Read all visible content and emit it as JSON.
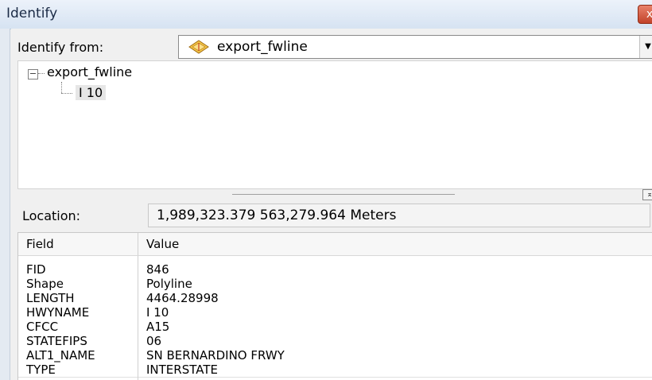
{
  "window": {
    "title": "Identify",
    "close_label": "x"
  },
  "identify_from": {
    "label": "Identify from:",
    "value": "export_fwline"
  },
  "tree": {
    "root_label": "export_fwline",
    "child_label": "I 10",
    "expander_symbol": "−"
  },
  "location": {
    "label": "Location:",
    "value": "1,989,323.379  563,279.964 Meters"
  },
  "fields_table": {
    "headers": [
      "Field",
      "Value"
    ],
    "rows": [
      [
        "FID",
        "846"
      ],
      [
        "Shape",
        "Polyline"
      ],
      [
        "LENGTH",
        "4464.28998"
      ],
      [
        "HWYNAME",
        "I 10"
      ],
      [
        "CFCC",
        "A15"
      ],
      [
        "STATEFIPS",
        "06"
      ],
      [
        "ALT1_NAME",
        "SN BERNARDINO FRWY"
      ],
      [
        "TYPE",
        "INTERSTATE"
      ]
    ]
  },
  "icons": [
    "layer-icon",
    "dropdown-arrow-icon",
    "close-icon",
    "pin-icon",
    "collapse-icon"
  ],
  "colors": {
    "titlebar": "#d6e3f2",
    "close_button": "#c2432a",
    "layer_icon_fill": "#f6c94a"
  }
}
